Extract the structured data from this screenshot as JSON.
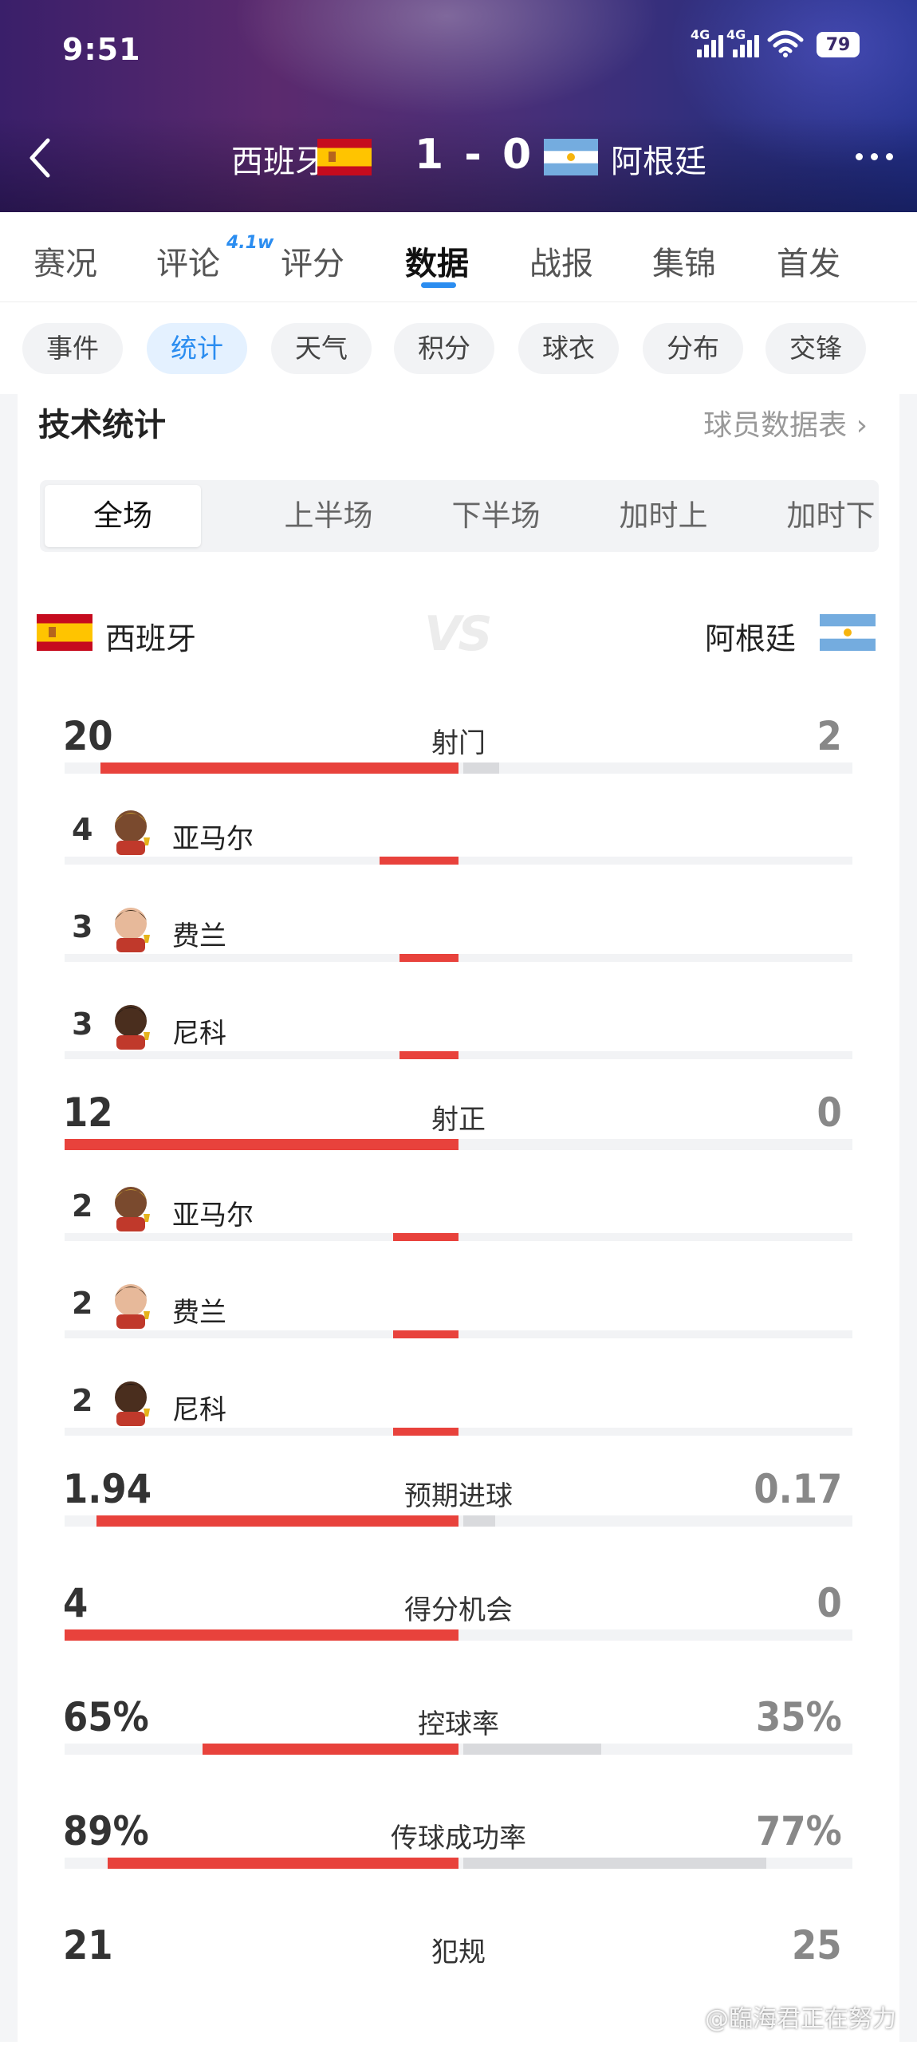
{
  "status_bar": {
    "time": "9:51",
    "net1": "4G",
    "net2": "4G",
    "battery": "79"
  },
  "header": {
    "home_team": "西班牙",
    "score": "1 - 0",
    "away_team": "阿根廷"
  },
  "tabs": [
    {
      "label": "赛况"
    },
    {
      "label": "评论",
      "badge": "4.1w"
    },
    {
      "label": "评分"
    },
    {
      "label": "数据",
      "active": true
    },
    {
      "label": "战报"
    },
    {
      "label": "集锦"
    },
    {
      "label": "首发"
    }
  ],
  "chips": [
    {
      "label": "事件"
    },
    {
      "label": "统计",
      "active": true
    },
    {
      "label": "天气"
    },
    {
      "label": "积分"
    },
    {
      "label": "球衣"
    },
    {
      "label": "分布"
    },
    {
      "label": "交锋"
    }
  ],
  "section": {
    "title": "技术统计",
    "link": "球员数据表"
  },
  "segments": [
    "全场",
    "上半场",
    "下半场",
    "加时上",
    "加时下"
  ],
  "teams": {
    "left": "西班牙",
    "vs": "VS",
    "right": "阿根廷"
  },
  "stats": [
    {
      "label": "射门",
      "left": "20",
      "right": "2",
      "left_fraction": 0.909,
      "right_fraction": 0.091,
      "players": [
        {
          "value": "4",
          "name": "亚马尔",
          "fraction": 0.2
        },
        {
          "value": "3",
          "name": "费兰",
          "fraction": 0.15
        },
        {
          "value": "3",
          "name": "尼科",
          "fraction": 0.15
        }
      ]
    },
    {
      "label": "射正",
      "left": "12",
      "right": "0",
      "left_fraction": 1.0,
      "right_fraction": 0.0,
      "players": [
        {
          "value": "2",
          "name": "亚马尔",
          "fraction": 0.167
        },
        {
          "value": "2",
          "name": "费兰",
          "fraction": 0.167
        },
        {
          "value": "2",
          "name": "尼科",
          "fraction": 0.167
        }
      ]
    },
    {
      "label": "预期进球",
      "left": "1.94",
      "right": "0.17",
      "left_fraction": 0.919,
      "right_fraction": 0.081
    },
    {
      "label": "得分机会",
      "left": "4",
      "right": "0",
      "left_fraction": 1.0,
      "right_fraction": 0.0
    },
    {
      "label": "控球率",
      "left": "65%",
      "right": "35%",
      "left_fraction": 0.65,
      "right_fraction": 0.35
    },
    {
      "label": "传球成功率",
      "left": "89%",
      "right": "77%",
      "left_fraction": 0.89,
      "right_fraction": 0.77
    },
    {
      "label": "犯规",
      "left": "21",
      "right": "25"
    }
  ],
  "watermark": "@臨海君正在努力",
  "colors": {
    "accent_blue": "#2b8df0",
    "bar_red": "#e8423c",
    "bar_gray": "#d9dadd"
  }
}
